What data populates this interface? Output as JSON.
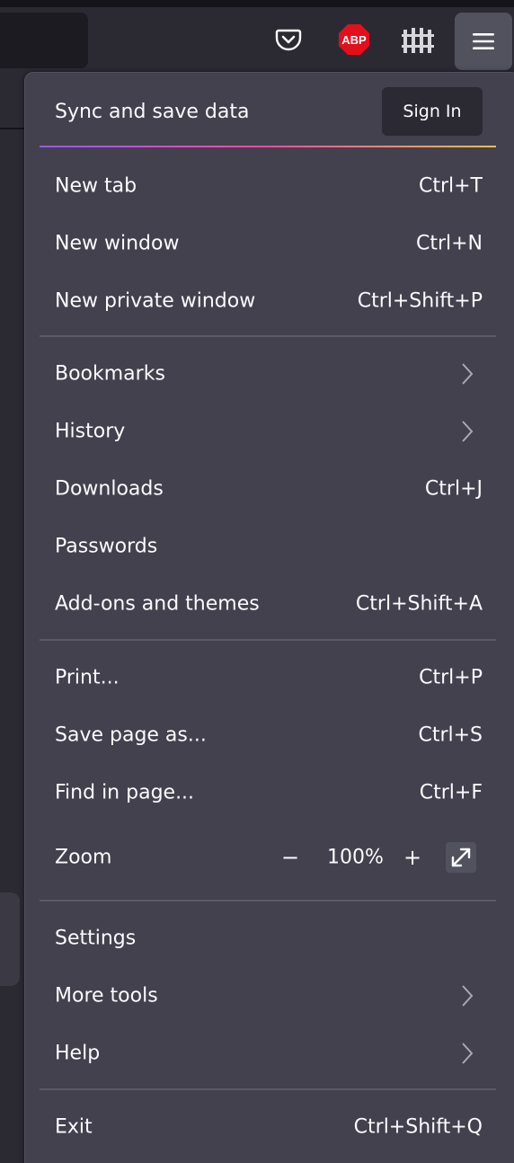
{
  "toolbar": {
    "icons": [
      "pocket-icon",
      "adblock-plus-icon",
      "extension-fence-icon",
      "hamburger-menu-icon"
    ],
    "abp_text": "ABP"
  },
  "menu": {
    "sync": {
      "label": "Sync and save data",
      "button": "Sign In"
    },
    "items": [
      {
        "label": "New tab",
        "shortcut": "Ctrl+T"
      },
      {
        "label": "New window",
        "shortcut": "Ctrl+N"
      },
      {
        "label": "New private window",
        "shortcut": "Ctrl+Shift+P"
      },
      {
        "label": "Bookmarks",
        "submenu": true
      },
      {
        "label": "History",
        "submenu": true
      },
      {
        "label": "Downloads",
        "shortcut": "Ctrl+J"
      },
      {
        "label": "Passwords"
      },
      {
        "label": "Add-ons and themes",
        "shortcut": "Ctrl+Shift+A"
      },
      {
        "label": "Print...",
        "shortcut": "Ctrl+P"
      },
      {
        "label": "Save page as...",
        "shortcut": "Ctrl+S"
      },
      {
        "label": "Find in page...",
        "shortcut": "Ctrl+F"
      },
      {
        "label": "Zoom"
      },
      {
        "label": "Settings"
      },
      {
        "label": "More tools",
        "submenu": true
      },
      {
        "label": "Help",
        "submenu": true
      },
      {
        "label": "Exit",
        "shortcut": "Ctrl+Shift+Q"
      }
    ],
    "zoom": {
      "minus": "−",
      "value": "100%",
      "plus": "+"
    }
  },
  "colors": {
    "panel_bg": "#42414d",
    "toolbar_bg": "#2b2a33",
    "accent_gradient": [
      "#9059ff",
      "#ff4aa2",
      "#ffbd4f"
    ],
    "abp_red": "#e40f1c"
  }
}
